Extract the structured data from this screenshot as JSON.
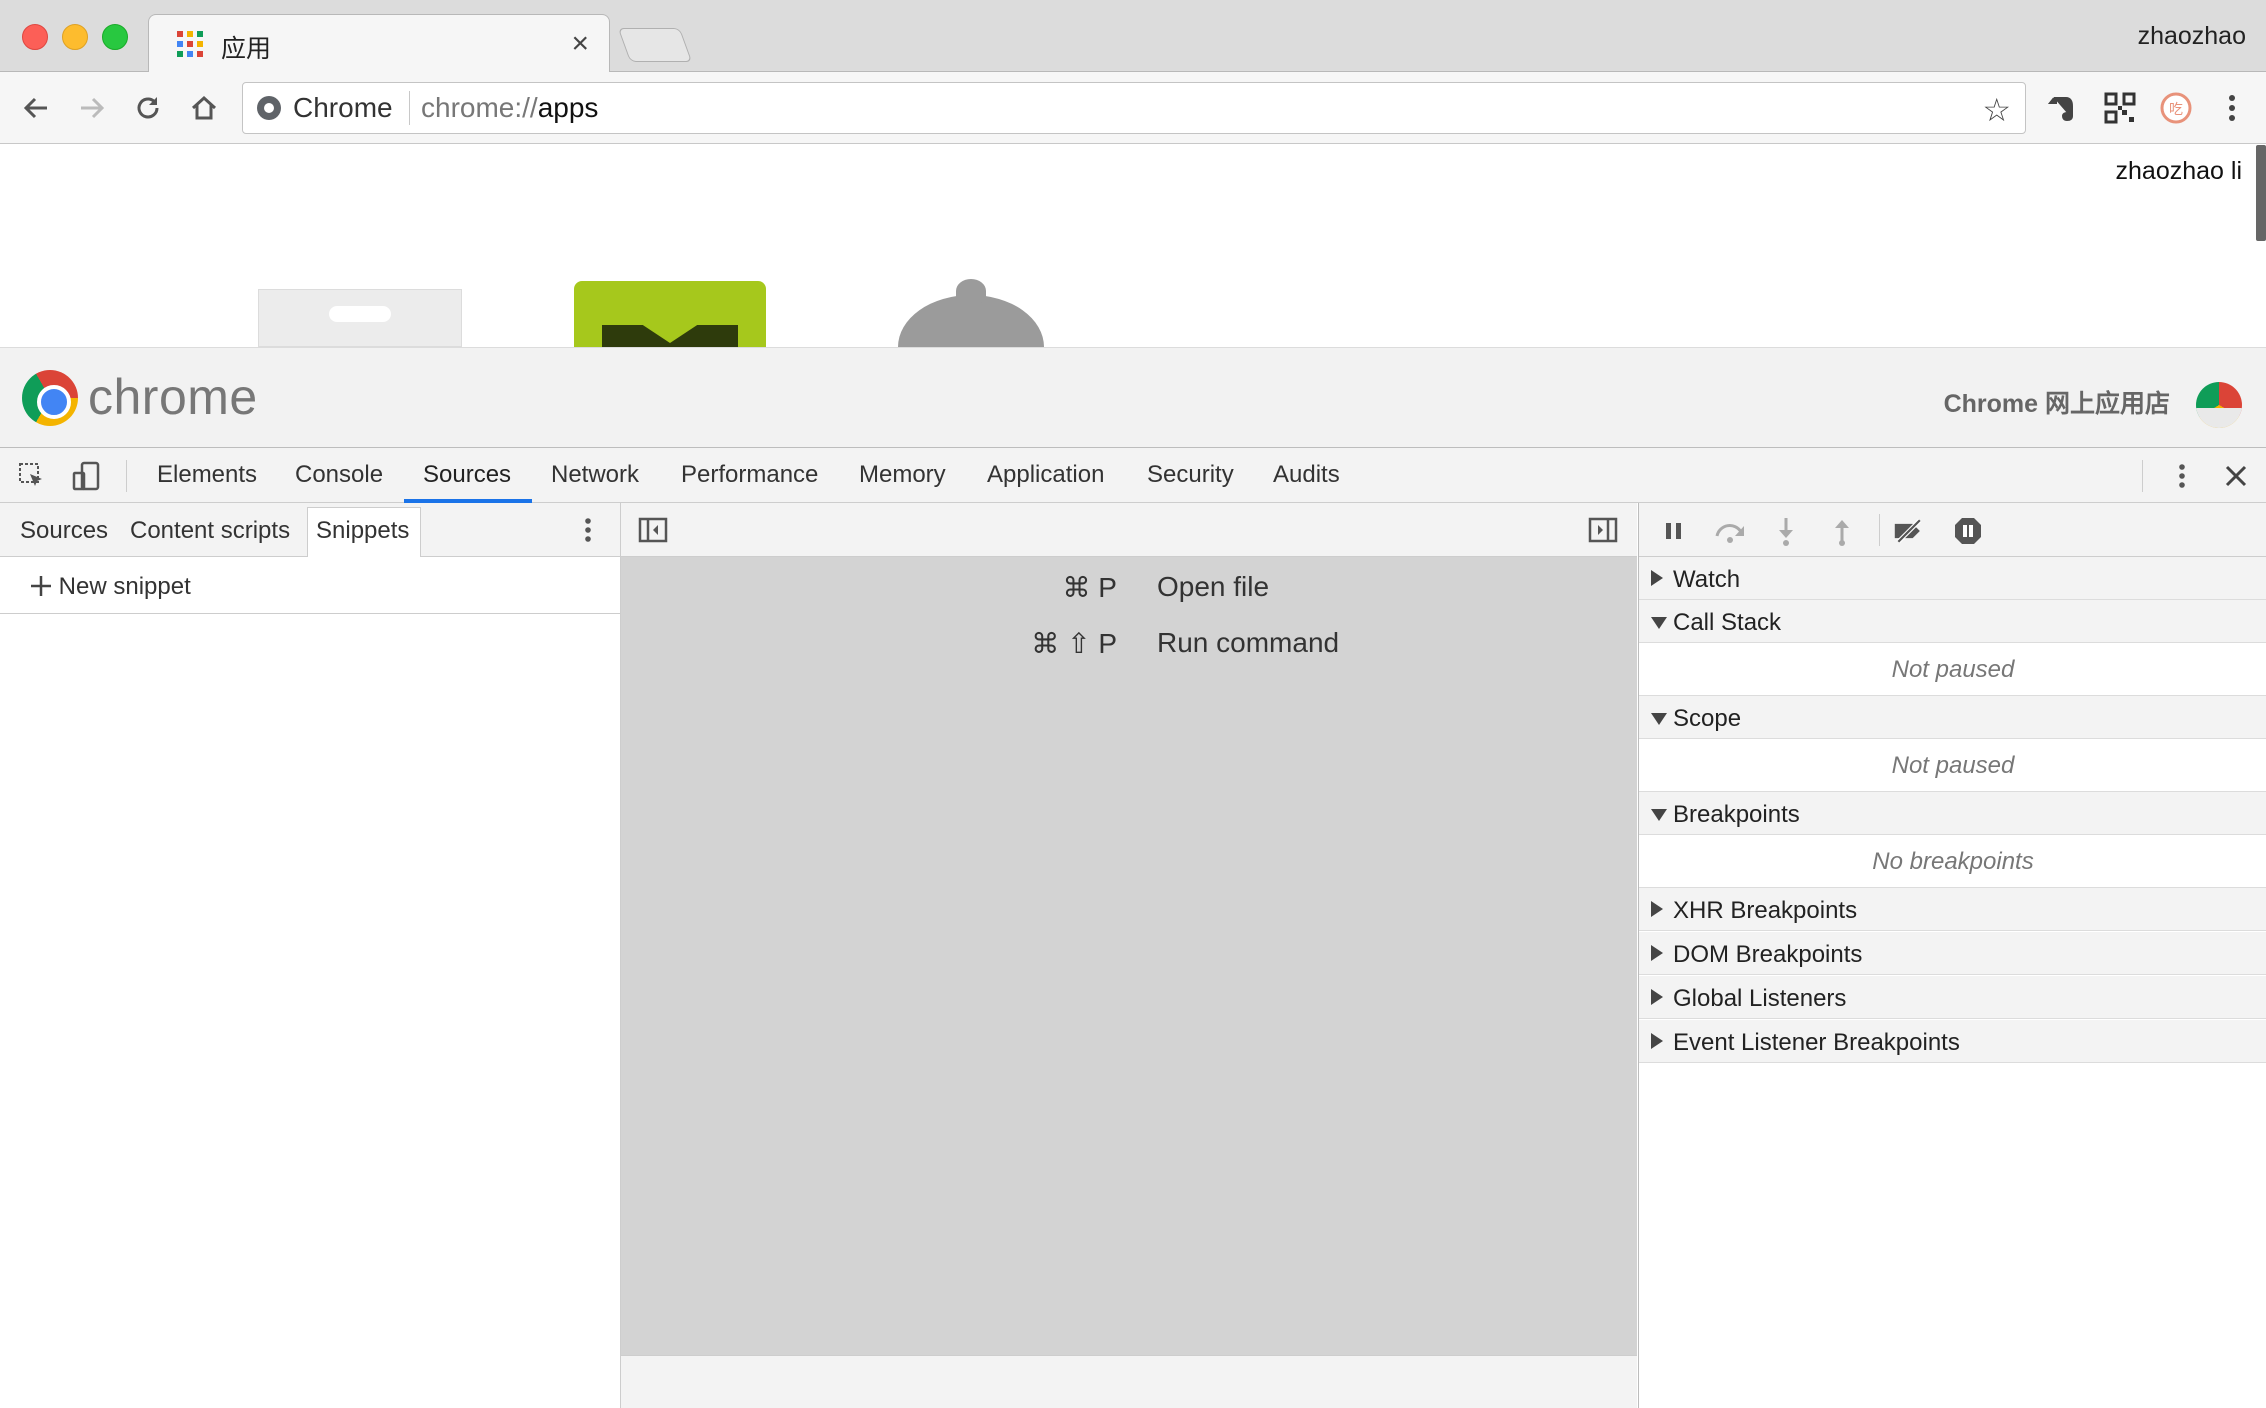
{
  "browser": {
    "tab_title": "应用",
    "tab_close": "×",
    "profile_name": "zhaozhao",
    "omnibox": {
      "chip": "Chrome",
      "url_scheme": "chrome://",
      "url_host": "apps"
    }
  },
  "page": {
    "user_name": "zhaozhao li",
    "store_wordmark": "chrome",
    "store_link": "Chrome 网上应用店"
  },
  "devtools": {
    "tabs": [
      "Elements",
      "Console",
      "Sources",
      "Network",
      "Performance",
      "Memory",
      "Application",
      "Security",
      "Audits"
    ],
    "active_tab": "Sources",
    "navigator_tabs": [
      "Sources",
      "Content scripts",
      "Snippets"
    ],
    "active_navigator_tab": "Snippets",
    "new_snippet_label": "New snippet",
    "shortcuts": [
      {
        "keys": "⌘ P",
        "action": "Open file"
      },
      {
        "keys": "⌘ ⇧ P",
        "action": "Run command"
      }
    ],
    "debugger_panes": {
      "watch": "Watch",
      "call_stack": "Call Stack",
      "call_stack_empty": "Not paused",
      "scope": "Scope",
      "scope_empty": "Not paused",
      "breakpoints": "Breakpoints",
      "breakpoints_empty": "No breakpoints",
      "xhr_breakpoints": "XHR Breakpoints",
      "dom_breakpoints": "DOM Breakpoints",
      "global_listeners": "Global Listeners",
      "event_listener_breakpoints": "Event Listener Breakpoints"
    }
  },
  "colors": {
    "accent_tab_underline": "#1a73e8",
    "editor_background": "#d3d3d3"
  }
}
